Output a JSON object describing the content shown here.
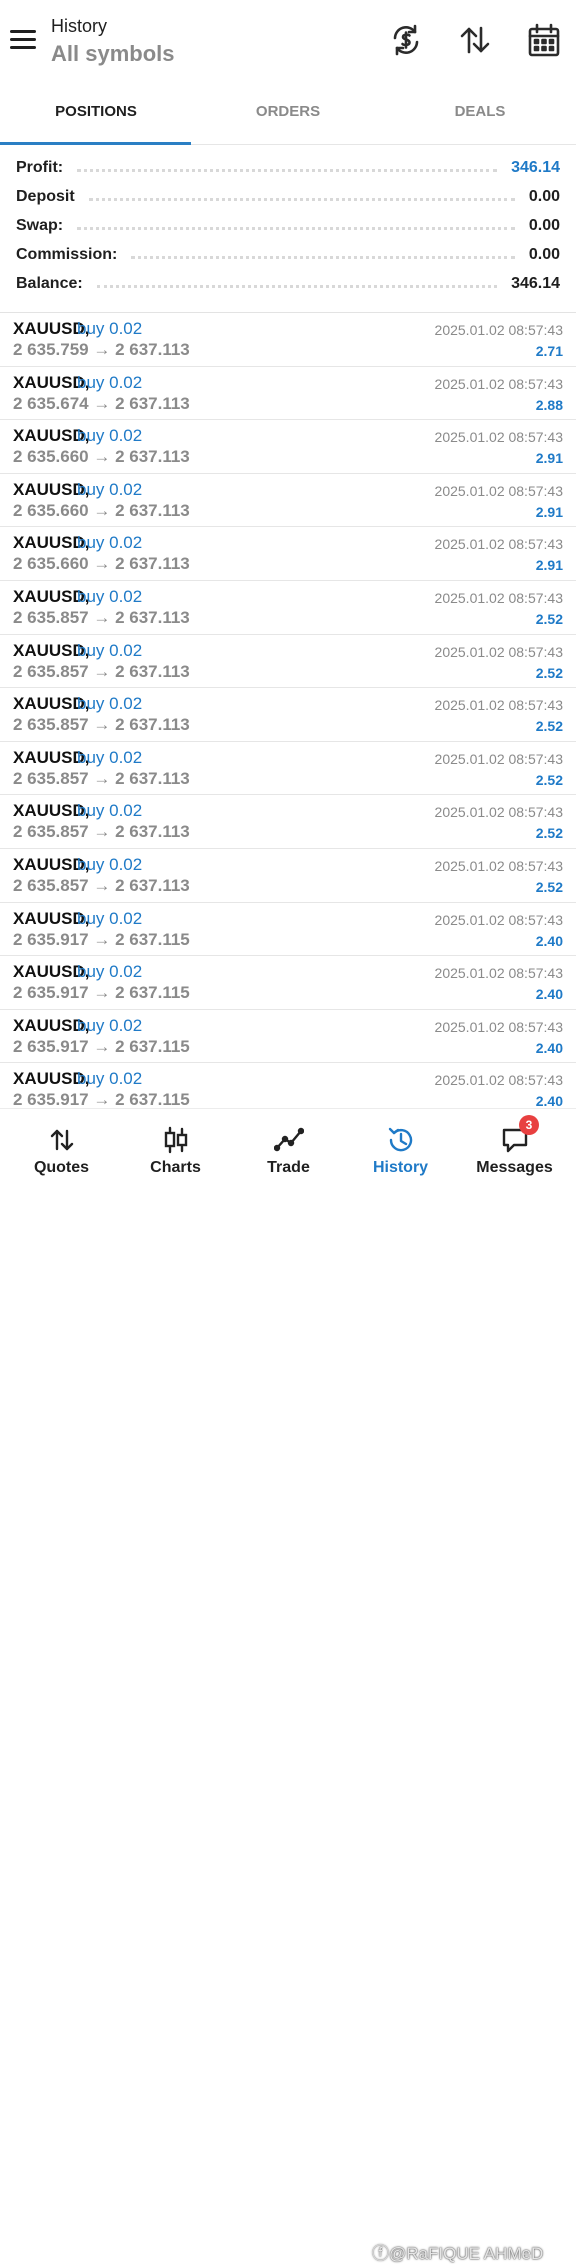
{
  "header": {
    "title": "History",
    "subtitle": "All symbols",
    "icons": [
      "currency-sync-icon",
      "sort-icon",
      "calendar-icon"
    ]
  },
  "tabs": [
    {
      "label": "POSITIONS",
      "active": true
    },
    {
      "label": "ORDERS",
      "active": false
    },
    {
      "label": "DEALS",
      "active": false
    }
  ],
  "summary": {
    "profit": {
      "label": "Profit:",
      "value": "346.14"
    },
    "deposit": {
      "label": "Deposit",
      "value": "0.00"
    },
    "swap": {
      "label": "Swap:",
      "value": "0.00"
    },
    "commission": {
      "label": "Commission:",
      "value": "0.00"
    },
    "balance": {
      "label": "Balance:",
      "value": "346.14"
    }
  },
  "positions": [
    {
      "symbol": "XAUUSD,",
      "direction": "buy 0.02",
      "prices": "2 635.759 → 2 637.113",
      "time": "2025.01.02 08:57:43",
      "profit": "2.71"
    },
    {
      "symbol": "XAUUSD,",
      "direction": "buy 0.02",
      "prices": "2 635.674 → 2 637.113",
      "time": "2025.01.02 08:57:43",
      "profit": "2.88"
    },
    {
      "symbol": "XAUUSD,",
      "direction": "buy 0.02",
      "prices": "2 635.660 → 2 637.113",
      "time": "2025.01.02 08:57:43",
      "profit": "2.91"
    },
    {
      "symbol": "XAUUSD,",
      "direction": "buy 0.02",
      "prices": "2 635.660 → 2 637.113",
      "time": "2025.01.02 08:57:43",
      "profit": "2.91"
    },
    {
      "symbol": "XAUUSD,",
      "direction": "buy 0.02",
      "prices": "2 635.660 → 2 637.113",
      "time": "2025.01.02 08:57:43",
      "profit": "2.91"
    },
    {
      "symbol": "XAUUSD,",
      "direction": "buy 0.02",
      "prices": "2 635.857 → 2 637.113",
      "time": "2025.01.02 08:57:43",
      "profit": "2.52"
    },
    {
      "symbol": "XAUUSD,",
      "direction": "buy 0.02",
      "prices": "2 635.857 → 2 637.113",
      "time": "2025.01.02 08:57:43",
      "profit": "2.52"
    },
    {
      "symbol": "XAUUSD,",
      "direction": "buy 0.02",
      "prices": "2 635.857 → 2 637.113",
      "time": "2025.01.02 08:57:43",
      "profit": "2.52"
    },
    {
      "symbol": "XAUUSD,",
      "direction": "buy 0.02",
      "prices": "2 635.857 → 2 637.113",
      "time": "2025.01.02 08:57:43",
      "profit": "2.52"
    },
    {
      "symbol": "XAUUSD,",
      "direction": "buy 0.02",
      "prices": "2 635.857 → 2 637.113",
      "time": "2025.01.02 08:57:43",
      "profit": "2.52"
    },
    {
      "symbol": "XAUUSD,",
      "direction": "buy 0.02",
      "prices": "2 635.857 → 2 637.113",
      "time": "2025.01.02 08:57:43",
      "profit": "2.52"
    },
    {
      "symbol": "XAUUSD,",
      "direction": "buy 0.02",
      "prices": "2 635.917 → 2 637.115",
      "time": "2025.01.02 08:57:43",
      "profit": "2.40"
    },
    {
      "symbol": "XAUUSD,",
      "direction": "buy 0.02",
      "prices": "2 635.917 → 2 637.115",
      "time": "2025.01.02 08:57:43",
      "profit": "2.40"
    },
    {
      "symbol": "XAUUSD,",
      "direction": "buy 0.02",
      "prices": "2 635.917 → 2 637.115",
      "time": "2025.01.02 08:57:43",
      "profit": "2.40"
    },
    {
      "symbol": "XAUUSD,",
      "direction": "buy 0.02",
      "prices": "2 635.917 → 2 637.115",
      "time": "2025.01.02 08:57:43",
      "profit": "2.40"
    }
  ],
  "bottom_nav": [
    {
      "label": "Quotes",
      "icon": "quotes-icon",
      "active": false
    },
    {
      "label": "Charts",
      "icon": "charts-icon",
      "active": false
    },
    {
      "label": "Trade",
      "icon": "trade-icon",
      "active": false
    },
    {
      "label": "History",
      "icon": "history-icon",
      "active": true
    },
    {
      "label": "Messages",
      "icon": "messages-icon",
      "active": false,
      "badge": "3"
    }
  ],
  "watermark": "ⓕ@RaFIQUE AHMeD",
  "colors": {
    "accent": "#1f7ac7",
    "tab_underline": "#2a7fc4",
    "muted": "#8a8a8a",
    "badge": "#e84040"
  }
}
